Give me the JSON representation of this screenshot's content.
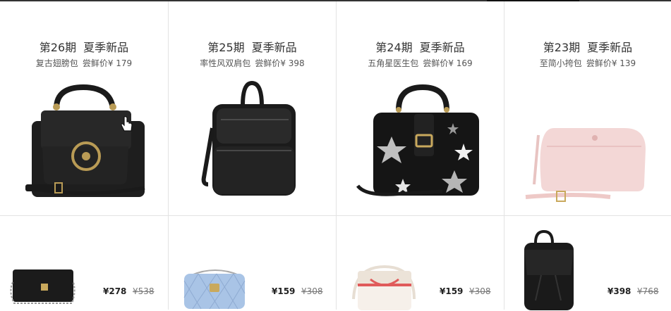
{
  "cards": [
    {
      "issue": "第26期",
      "theme": "夏季新品",
      "name": "复古翅膀包",
      "price_label": "尝鲜价",
      "price": "¥ 179",
      "image": "black-wing-handbag"
    },
    {
      "issue": "第25期",
      "theme": "夏季新品",
      "name": "率性风双肩包",
      "price_label": "尝鲜价",
      "price": "¥ 398",
      "image": "black-backpack"
    },
    {
      "issue": "第24期",
      "theme": "夏季新品",
      "name": "五角星医生包",
      "price_label": "尝鲜价",
      "price": "¥ 169",
      "image": "black-star-doctor-bag"
    },
    {
      "issue": "第23期",
      "theme": "夏季新品",
      "name": "至简小挎包",
      "price_label": "尝鲜价",
      "price": "¥ 139",
      "image": "pink-crossbody-bag"
    }
  ],
  "products": [
    {
      "price": "¥278",
      "old_price": "¥538",
      "image": "black-chain-bag"
    },
    {
      "price": "¥159",
      "old_price": "¥308",
      "image": "blue-quilted-bag"
    },
    {
      "price": "¥159",
      "old_price": "¥308",
      "image": "white-bow-bag"
    },
    {
      "price": "¥398",
      "old_price": "¥768",
      "image": "black-drawstring-backpack"
    }
  ],
  "colors": {
    "border": "#e3e3e3",
    "text": "#333333",
    "accent": "#111111"
  }
}
